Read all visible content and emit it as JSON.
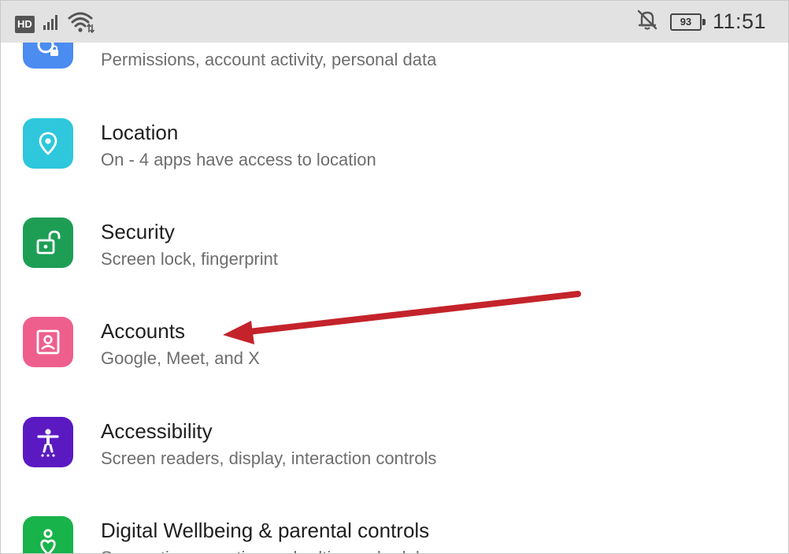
{
  "status_bar": {
    "hd_label": "HD",
    "battery_level": "93",
    "time": "11:51",
    "icons": [
      "signal-icon",
      "wifi-icon",
      "notifications-off-icon",
      "battery-icon"
    ]
  },
  "settings_items": [
    {
      "id": "privacy",
      "title": "",
      "subtitle": "Permissions, account activity, personal data",
      "icon": "privacy-icon",
      "color": "#4a8cf0"
    },
    {
      "id": "location",
      "title": "Location",
      "subtitle": "On - 4 apps have access to location",
      "icon": "location-pin-icon",
      "color": "#2ec7dc"
    },
    {
      "id": "security",
      "title": "Security",
      "subtitle": "Screen lock, fingerprint",
      "icon": "unlocked-padlock-icon",
      "color": "#1e9e55"
    },
    {
      "id": "accounts",
      "title": "Accounts",
      "subtitle": "Google, Meet, and X",
      "icon": "account-box-icon",
      "color": "#ee5f8e"
    },
    {
      "id": "accessibility",
      "title": "Accessibility",
      "subtitle": "Screen readers, display, interaction controls",
      "icon": "accessibility-person-icon",
      "color": "#5b19c2"
    },
    {
      "id": "wellbeing",
      "title": "Digital Wellbeing & parental controls",
      "subtitle": "Screen time, app timers, bedtime schedules",
      "icon": "wellbeing-icon",
      "color": "#18b34a"
    }
  ],
  "annotation": {
    "type": "arrow",
    "color": "#c4232b",
    "points_to": "Accounts"
  }
}
